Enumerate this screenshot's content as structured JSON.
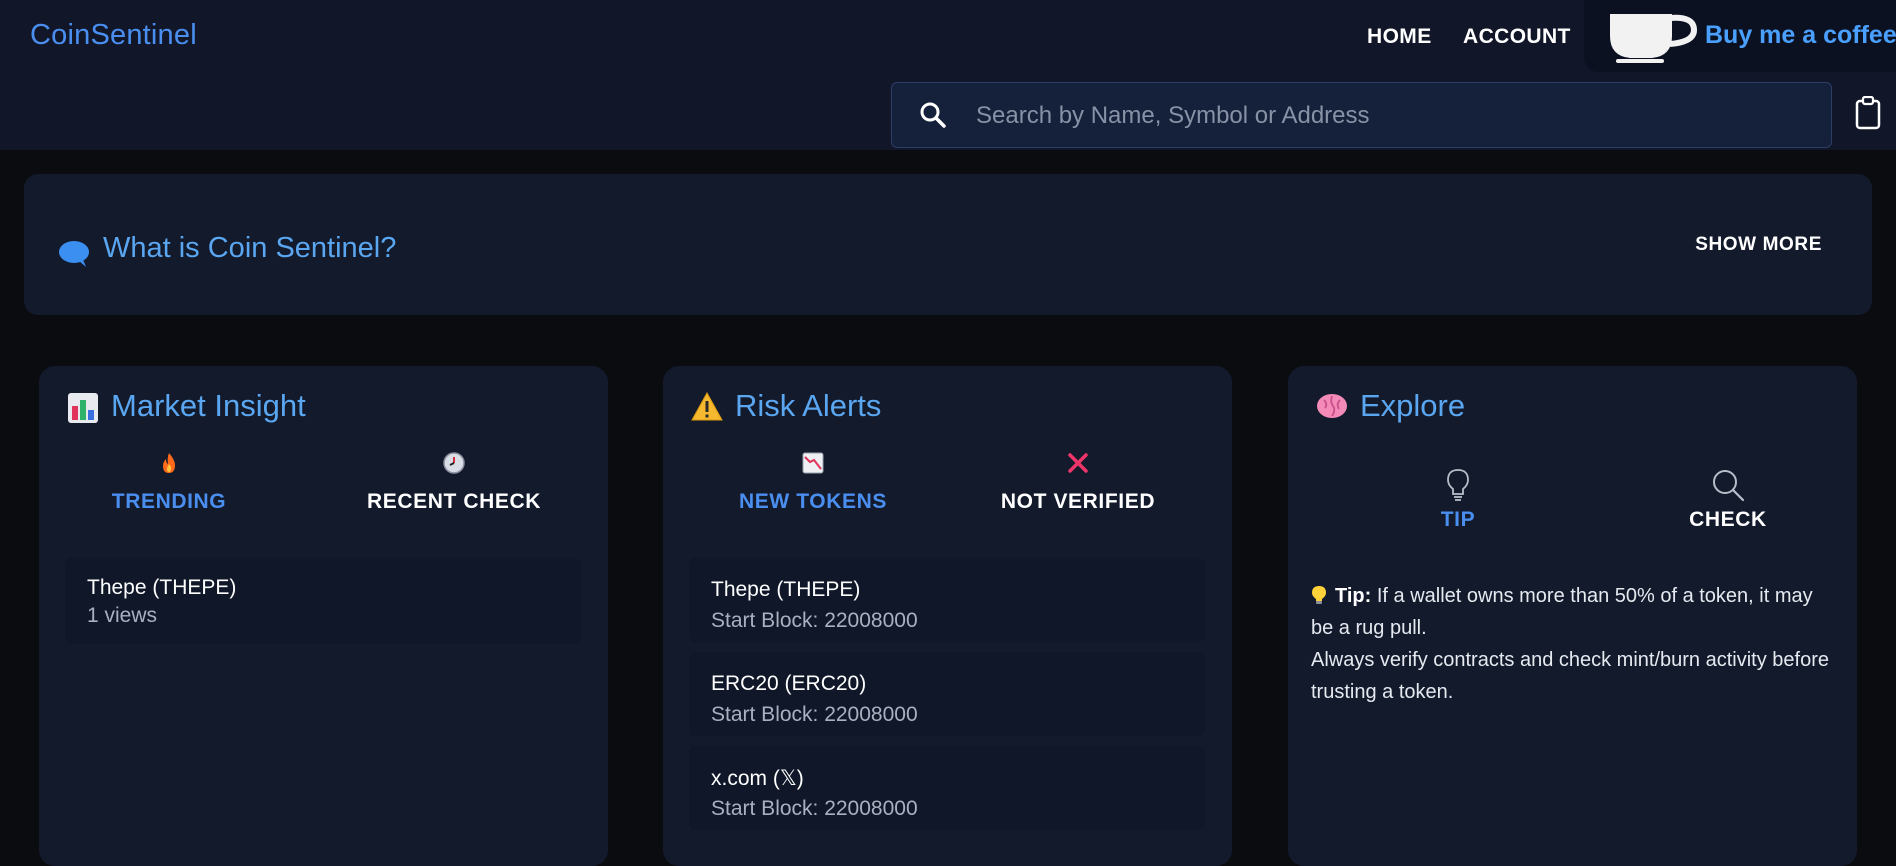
{
  "header": {
    "logo": "CoinSentinel",
    "nav": {
      "home": "HOME",
      "account": "ACCOUNT"
    },
    "coffee_label": "Buy me a coffee",
    "search_placeholder": "Search by Name, Symbol or Address"
  },
  "about": {
    "title": "What is Coin Sentinel?",
    "show_more": "SHOW MORE"
  },
  "market": {
    "title": "Market Insight",
    "tabs": [
      {
        "label": "TRENDING",
        "icon": "fire-icon",
        "active": true
      },
      {
        "label": "RECENT CHECK",
        "icon": "clock-icon",
        "active": false
      }
    ],
    "items": [
      {
        "name": "Thepe (THEPE)",
        "sub": "1 views"
      }
    ]
  },
  "risk": {
    "title": "Risk Alerts",
    "tabs": [
      {
        "label": "NEW TOKENS",
        "icon": "chart-decreasing-icon",
        "active": true
      },
      {
        "label": "NOT VERIFIED",
        "icon": "cross-mark-icon",
        "active": false
      }
    ],
    "items": [
      {
        "name": "Thepe (THEPE)",
        "sub": "Start Block: 22008000"
      },
      {
        "name": "ERC20 (ERC20)",
        "sub": "Start Block: 22008000"
      },
      {
        "name": "x.com (𝕏)",
        "sub": "Start Block: 22008000"
      }
    ]
  },
  "explore": {
    "title": "Explore",
    "tabs": [
      {
        "label": "TIP",
        "icon": "lightbulb-icon",
        "active": true
      },
      {
        "label": "CHECK",
        "icon": "search-icon",
        "active": false
      }
    ],
    "tip_label": "Tip:",
    "tip_line1": "If a wallet owns more than 50% of a token, it may be a rug pull.",
    "tip_line2": "Always verify contracts and check mint/burn activity before trusting a token."
  },
  "colors": {
    "accent": "#4a8ef0",
    "background": "#0b0c0f",
    "header_bg": "#111729",
    "card_bg": "#121a2c"
  }
}
